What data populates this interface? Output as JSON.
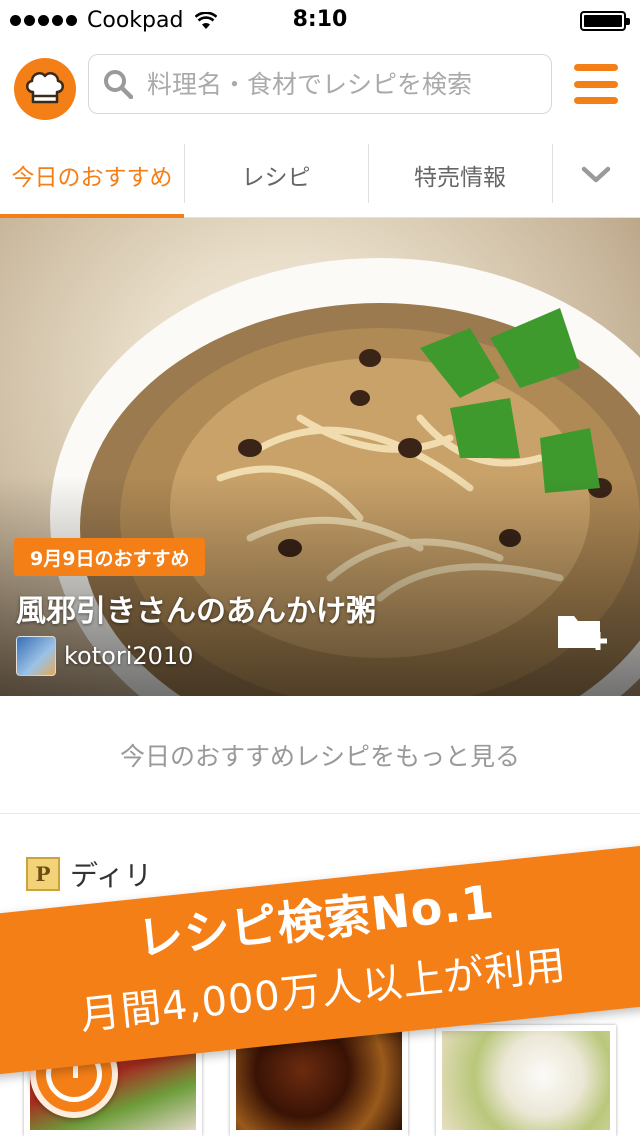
{
  "status_bar": {
    "carrier": "Cookpad",
    "time": "8:10"
  },
  "header": {
    "logo_icon": "chef-hat-icon",
    "search_placeholder": "料理名・食材でレシピを検索",
    "menu_icon": "hamburger-menu-icon"
  },
  "tabs": [
    {
      "label": "今日のおすすめ",
      "active": true
    },
    {
      "label": "レシピ",
      "active": false
    },
    {
      "label": "特売情報",
      "active": false
    }
  ],
  "hero": {
    "badge": "9月9日のおすすめ",
    "title": "風邪引きさんのあんかけ粥",
    "author": "kotori2010",
    "save_icon": "folder-add-icon"
  },
  "more_link": "今日のおすすめレシピをもっと見る",
  "section": {
    "icon_letter": "P",
    "title": "ディリ"
  },
  "promo": {
    "line1": "レシピ検索No.1",
    "line2": "月間4,000万人以上が利用"
  },
  "colors": {
    "accent": "#f57f17",
    "text_muted": "#999999"
  }
}
